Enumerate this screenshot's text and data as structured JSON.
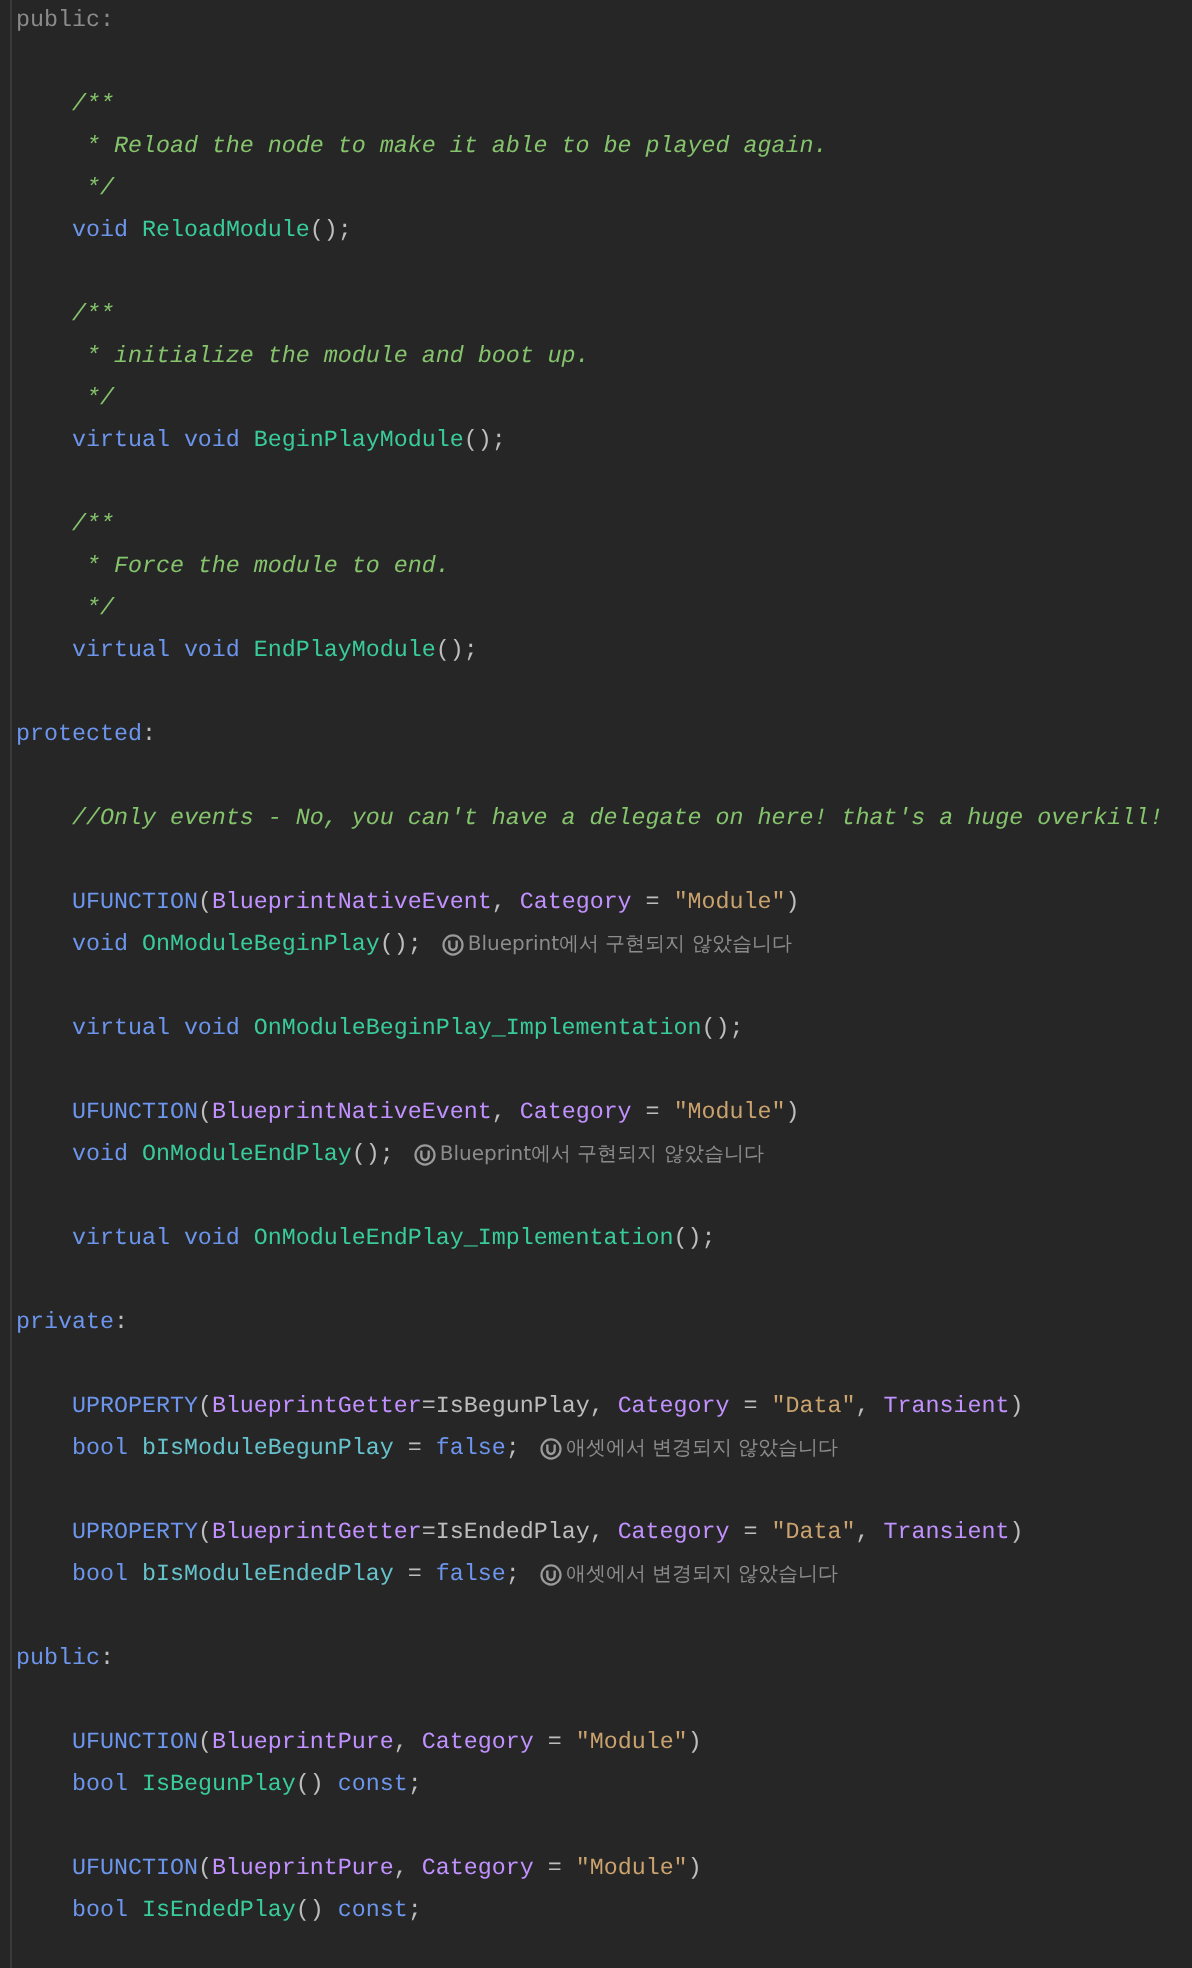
{
  "editor": {
    "lines": [
      {
        "kind": "code",
        "tokens": [
          {
            "text": "public:",
            "kind": "inactive"
          }
        ]
      },
      {
        "kind": "blank"
      },
      {
        "kind": "code",
        "tokens": [
          {
            "text": "    /**",
            "kind": "comment"
          }
        ]
      },
      {
        "kind": "code",
        "tokens": [
          {
            "text": "     * Reload the node to make it able to be played again.",
            "kind": "comment"
          }
        ]
      },
      {
        "kind": "code",
        "tokens": [
          {
            "text": "     */",
            "kind": "comment"
          }
        ]
      },
      {
        "kind": "code",
        "tokens": [
          {
            "text": "    void ",
            "kind": "keyword"
          },
          {
            "text": "ReloadModule",
            "kind": "func"
          },
          {
            "text": "();",
            "kind": "plain"
          }
        ]
      },
      {
        "kind": "blank"
      },
      {
        "kind": "code",
        "tokens": [
          {
            "text": "    /**",
            "kind": "comment"
          }
        ]
      },
      {
        "kind": "code",
        "tokens": [
          {
            "text": "     * initialize the module and boot up.",
            "kind": "comment"
          }
        ]
      },
      {
        "kind": "code",
        "tokens": [
          {
            "text": "     */",
            "kind": "comment"
          }
        ]
      },
      {
        "kind": "code",
        "tokens": [
          {
            "text": "    virtual void ",
            "kind": "keyword"
          },
          {
            "text": "BeginPlayModule",
            "kind": "func"
          },
          {
            "text": "();",
            "kind": "plain"
          }
        ]
      },
      {
        "kind": "blank"
      },
      {
        "kind": "code",
        "tokens": [
          {
            "text": "    /**",
            "kind": "comment"
          }
        ]
      },
      {
        "kind": "code",
        "tokens": [
          {
            "text": "     * Force the module to end.",
            "kind": "comment"
          }
        ]
      },
      {
        "kind": "code",
        "tokens": [
          {
            "text": "     */",
            "kind": "comment"
          }
        ]
      },
      {
        "kind": "code",
        "tokens": [
          {
            "text": "    virtual void ",
            "kind": "keyword"
          },
          {
            "text": "EndPlayModule",
            "kind": "func"
          },
          {
            "text": "();",
            "kind": "plain"
          }
        ]
      },
      {
        "kind": "blank"
      },
      {
        "kind": "code",
        "tokens": [
          {
            "text": "protected",
            "kind": "keyword"
          },
          {
            "text": ":",
            "kind": "plain"
          }
        ]
      },
      {
        "kind": "blank"
      },
      {
        "kind": "code",
        "tokens": [
          {
            "text": "    //Only events - No, you can't have a delegate on here! that's a huge overkill!",
            "kind": "comment"
          }
        ]
      },
      {
        "kind": "blank"
      },
      {
        "kind": "code",
        "tokens": [
          {
            "text": "    UFUNCTION",
            "kind": "keyword"
          },
          {
            "text": "(",
            "kind": "plain"
          },
          {
            "text": "BlueprintNativeEvent",
            "kind": "attr"
          },
          {
            "text": ", ",
            "kind": "plain"
          },
          {
            "text": "Category",
            "kind": "attr"
          },
          {
            "text": " = ",
            "kind": "plain"
          },
          {
            "text": "\"Module\"",
            "kind": "string"
          },
          {
            "text": ")",
            "kind": "plain"
          }
        ]
      },
      {
        "kind": "code",
        "tokens": [
          {
            "text": "    void ",
            "kind": "keyword"
          },
          {
            "text": "OnModuleBeginPlay",
            "kind": "func"
          },
          {
            "text": "();",
            "kind": "plain"
          }
        ],
        "hint": "Blueprint에서 구현되지 않았습니다"
      },
      {
        "kind": "blank"
      },
      {
        "kind": "code",
        "tokens": [
          {
            "text": "    virtual void ",
            "kind": "keyword"
          },
          {
            "text": "OnModuleBeginPlay_Implementation",
            "kind": "func"
          },
          {
            "text": "();",
            "kind": "plain"
          }
        ]
      },
      {
        "kind": "blank"
      },
      {
        "kind": "code",
        "tokens": [
          {
            "text": "    UFUNCTION",
            "kind": "keyword"
          },
          {
            "text": "(",
            "kind": "plain"
          },
          {
            "text": "BlueprintNativeEvent",
            "kind": "attr"
          },
          {
            "text": ", ",
            "kind": "plain"
          },
          {
            "text": "Category",
            "kind": "attr"
          },
          {
            "text": " = ",
            "kind": "plain"
          },
          {
            "text": "\"Module\"",
            "kind": "string"
          },
          {
            "text": ")",
            "kind": "plain"
          }
        ]
      },
      {
        "kind": "code",
        "tokens": [
          {
            "text": "    void ",
            "kind": "keyword"
          },
          {
            "text": "OnModuleEndPlay",
            "kind": "func"
          },
          {
            "text": "();",
            "kind": "plain"
          }
        ],
        "hint": "Blueprint에서 구현되지 않았습니다"
      },
      {
        "kind": "blank"
      },
      {
        "kind": "code",
        "tokens": [
          {
            "text": "    virtual void ",
            "kind": "keyword"
          },
          {
            "text": "OnModuleEndPlay_Implementation",
            "kind": "func"
          },
          {
            "text": "();",
            "kind": "plain"
          }
        ]
      },
      {
        "kind": "blank"
      },
      {
        "kind": "code",
        "tokens": [
          {
            "text": "private",
            "kind": "keyword"
          },
          {
            "text": ":",
            "kind": "plain"
          }
        ]
      },
      {
        "kind": "blank"
      },
      {
        "kind": "code",
        "tokens": [
          {
            "text": "    UPROPERTY",
            "kind": "keyword"
          },
          {
            "text": "(",
            "kind": "plain"
          },
          {
            "text": "BlueprintGetter",
            "kind": "attr"
          },
          {
            "text": "=IsBegunPlay, ",
            "kind": "plain"
          },
          {
            "text": "Category",
            "kind": "attr"
          },
          {
            "text": " = ",
            "kind": "plain"
          },
          {
            "text": "\"Data\"",
            "kind": "string"
          },
          {
            "text": ", ",
            "kind": "plain"
          },
          {
            "text": "Transient",
            "kind": "attr"
          },
          {
            "text": ")",
            "kind": "plain"
          }
        ]
      },
      {
        "kind": "code",
        "tokens": [
          {
            "text": "    bool ",
            "kind": "keyword"
          },
          {
            "text": "bIsModuleBegunPlay",
            "kind": "field"
          },
          {
            "text": " = ",
            "kind": "plain"
          },
          {
            "text": "false",
            "kind": "keyword"
          },
          {
            "text": ";",
            "kind": "plain"
          }
        ],
        "hint": "애셋에서 변경되지 않았습니다"
      },
      {
        "kind": "blank"
      },
      {
        "kind": "code",
        "tokens": [
          {
            "text": "    UPROPERTY",
            "kind": "keyword"
          },
          {
            "text": "(",
            "kind": "plain"
          },
          {
            "text": "BlueprintGetter",
            "kind": "attr"
          },
          {
            "text": "=IsEndedPlay, ",
            "kind": "plain"
          },
          {
            "text": "Category",
            "kind": "attr"
          },
          {
            "text": " = ",
            "kind": "plain"
          },
          {
            "text": "\"Data\"",
            "kind": "string"
          },
          {
            "text": ", ",
            "kind": "plain"
          },
          {
            "text": "Transient",
            "kind": "attr"
          },
          {
            "text": ")",
            "kind": "plain"
          }
        ]
      },
      {
        "kind": "code",
        "tokens": [
          {
            "text": "    bool ",
            "kind": "keyword"
          },
          {
            "text": "bIsModuleEndedPlay",
            "kind": "field"
          },
          {
            "text": " = ",
            "kind": "plain"
          },
          {
            "text": "false",
            "kind": "keyword"
          },
          {
            "text": ";",
            "kind": "plain"
          }
        ],
        "hint": "애셋에서 변경되지 않았습니다"
      },
      {
        "kind": "blank"
      },
      {
        "kind": "code",
        "tokens": [
          {
            "text": "public",
            "kind": "keyword"
          },
          {
            "text": ":",
            "kind": "plain"
          }
        ]
      },
      {
        "kind": "blank"
      },
      {
        "kind": "code",
        "tokens": [
          {
            "text": "    UFUNCTION",
            "kind": "keyword"
          },
          {
            "text": "(",
            "kind": "plain"
          },
          {
            "text": "BlueprintPure",
            "kind": "attr"
          },
          {
            "text": ", ",
            "kind": "plain"
          },
          {
            "text": "Category",
            "kind": "attr"
          },
          {
            "text": " = ",
            "kind": "plain"
          },
          {
            "text": "\"Module\"",
            "kind": "string"
          },
          {
            "text": ")",
            "kind": "plain"
          }
        ]
      },
      {
        "kind": "code",
        "tokens": [
          {
            "text": "    bool ",
            "kind": "keyword"
          },
          {
            "text": "IsBegunPlay",
            "kind": "func"
          },
          {
            "text": "() ",
            "kind": "plain"
          },
          {
            "text": "const",
            "kind": "keyword"
          },
          {
            "text": ";",
            "kind": "plain"
          }
        ]
      },
      {
        "kind": "blank"
      },
      {
        "kind": "code",
        "tokens": [
          {
            "text": "    UFUNCTION",
            "kind": "keyword"
          },
          {
            "text": "(",
            "kind": "plain"
          },
          {
            "text": "BlueprintPure",
            "kind": "attr"
          },
          {
            "text": ", ",
            "kind": "plain"
          },
          {
            "text": "Category",
            "kind": "attr"
          },
          {
            "text": " = ",
            "kind": "plain"
          },
          {
            "text": "\"Module\"",
            "kind": "string"
          },
          {
            "text": ")",
            "kind": "plain"
          }
        ]
      },
      {
        "kind": "code",
        "tokens": [
          {
            "text": "    bool ",
            "kind": "keyword"
          },
          {
            "text": "IsEndedPlay",
            "kind": "func"
          },
          {
            "text": "() ",
            "kind": "plain"
          },
          {
            "text": "const",
            "kind": "keyword"
          },
          {
            "text": ";",
            "kind": "plain"
          }
        ]
      }
    ]
  }
}
